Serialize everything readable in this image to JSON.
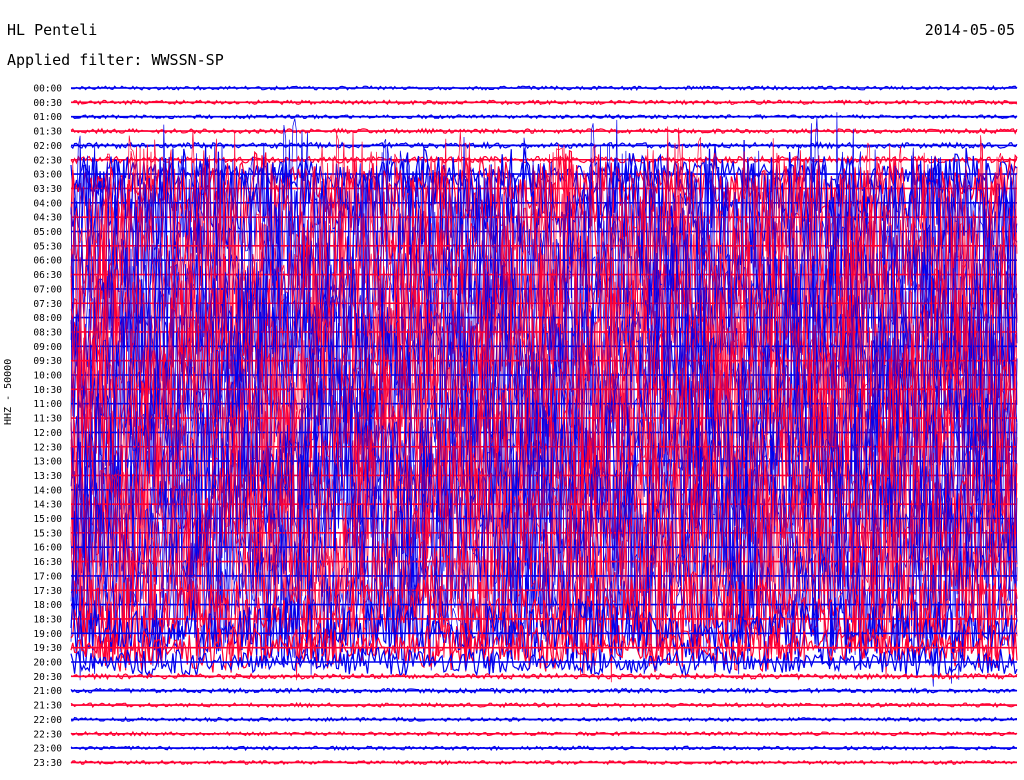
{
  "header": {
    "station": "HL Penteli",
    "date": "2014-05-05",
    "filter_label": "Applied filter: WWSSN-SP"
  },
  "chart_data": {
    "type": "line",
    "ylabel": "HHZ - 50000",
    "row_labels": [
      "00:00",
      "00:30",
      "01:00",
      "01:30",
      "02:00",
      "02:30",
      "03:00",
      "03:30",
      "04:00",
      "04:30",
      "05:00",
      "05:30",
      "06:00",
      "06:30",
      "07:00",
      "07:30",
      "08:00",
      "08:30",
      "09:00",
      "09:30",
      "10:00",
      "10:30",
      "11:00",
      "11:30",
      "12:00",
      "12:30",
      "13:00",
      "13:30",
      "14:00",
      "14:30",
      "15:00",
      "15:30",
      "16:00",
      "16:30",
      "17:00",
      "17:30",
      "18:00",
      "18:30",
      "19:00",
      "19:30",
      "20:00",
      "20:30",
      "21:00",
      "21:30",
      "22:00",
      "22:30",
      "23:00",
      "23:30"
    ],
    "trace_colors": [
      "#0000ee",
      "#ff0033"
    ],
    "grid": false,
    "relative_amplitude": [
      0.03,
      0.04,
      0.03,
      0.05,
      0.08,
      0.1,
      0.16,
      0.3,
      0.5,
      0.75,
      1.0,
      1.0,
      1.0,
      1.0,
      1.0,
      1.0,
      1.0,
      1.0,
      1.0,
      1.0,
      1.0,
      1.0,
      1.0,
      1.0,
      1.0,
      1.0,
      1.0,
      1.0,
      1.0,
      1.0,
      1.0,
      1.0,
      1.0,
      1.0,
      0.9,
      0.75,
      0.6,
      0.45,
      0.3,
      0.2,
      0.12,
      0.07,
      0.05,
      0.04,
      0.03,
      0.03,
      0.03,
      0.03
    ]
  }
}
